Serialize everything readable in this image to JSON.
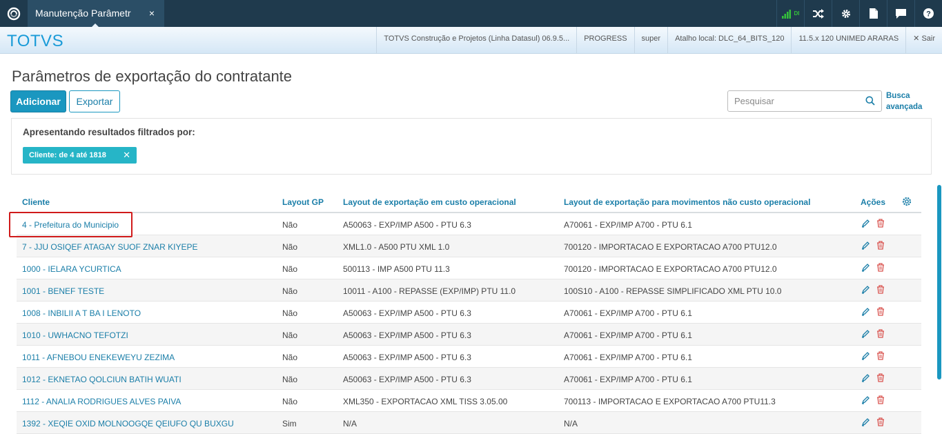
{
  "tab": {
    "title": "Manutenção Parâmetr",
    "close": "×"
  },
  "top_icons": [
    "signal-icon",
    "shuffle-icon",
    "gear-icon",
    "document-icon",
    "chat-icon",
    "help-icon"
  ],
  "signal_label": "DI",
  "header": {
    "brand": "TOTVS",
    "info": [
      "TOTVS Construção e Projetos (Linha Datasul) 06.9.5...",
      "PROGRESS",
      "super",
      "Atalho local: DLC_64_BITS_120",
      "11.5.x 120 UNIMED ARARAS"
    ],
    "logout": "Sair"
  },
  "page": {
    "title": "Parâmetros de exportação do contratante",
    "add_label": "Adicionar",
    "export_label": "Exportar",
    "search_placeholder": "Pesquisar",
    "advanced_search": "Busca avançada"
  },
  "filter": {
    "title": "Apresentando resultados filtrados por:",
    "chip": "Cliente: de 4 até 1818"
  },
  "table": {
    "headers": {
      "client": "Cliente",
      "layout_gp": "Layout GP",
      "layout_custo": "Layout de exportação em custo operacional",
      "layout_mov": "Layout de exportação para movimentos não custo operacional",
      "actions": "Ações"
    },
    "rows": [
      {
        "client": "4 - Prefeitura do Municipio",
        "gp": "Não",
        "l1": "A50063 - EXP/IMP A500 - PTU 6.3",
        "l2": "A70061 - EXP/IMP A700 - PTU 6.1"
      },
      {
        "client": "7 - JJU OSIQEF ATAGAY SUOF ZNAR KIYEPE",
        "gp": "Não",
        "l1": "XML1.0 - A500 PTU XML 1.0",
        "l2": "700120 - IMPORTACAO E EXPORTACAO A700 PTU12.0"
      },
      {
        "client": "1000 - IELARA YCURTICA",
        "gp": "Não",
        "l1": "500113 - IMP A500 PTU 11.3",
        "l2": "700120 - IMPORTACAO E EXPORTACAO A700 PTU12.0"
      },
      {
        "client": "1001 - BENEF TESTE",
        "gp": "Não",
        "l1": "10011 - A100 - REPASSE (EXP/IMP) PTU 11.0",
        "l2": "100S10 - A100 - REPASSE SIMPLIFICADO XML PTU 10.0"
      },
      {
        "client": "1008 - INBILII A T BA I LENOTO",
        "gp": "Não",
        "l1": "A50063 - EXP/IMP A500 - PTU 6.3",
        "l2": "A70061 - EXP/IMP A700 - PTU 6.1"
      },
      {
        "client": "1010 - UWHACNO TEFOTZI",
        "gp": "Não",
        "l1": "A50063 - EXP/IMP A500 - PTU 6.3",
        "l2": "A70061 - EXP/IMP A700 - PTU 6.1"
      },
      {
        "client": "1011 - AFNEBOU ENEKEWEYU ZEZIMA",
        "gp": "Não",
        "l1": "A50063 - EXP/IMP A500 - PTU 6.3",
        "l2": "A70061 - EXP/IMP A700 - PTU 6.1"
      },
      {
        "client": "1012 - EKNETAO QOLCIUN BATIH WUATI",
        "gp": "Não",
        "l1": "A50063 - EXP/IMP A500 - PTU 6.3",
        "l2": "A70061 - EXP/IMP A700 - PTU 6.1"
      },
      {
        "client": "1112 - ANALIA RODRIGUES ALVES PAIVA",
        "gp": "Não",
        "l1": "XML350 - EXPORTACAO XML TISS 3.05.00",
        "l2": "700113 - IMPORTACAO E EXPORTACAO A700 PTU11.3"
      },
      {
        "client": "1392 - XEQIE OXID MOLNOOGQE QEIUFO QU BUXGU",
        "gp": "Sim",
        "l1": "N/A",
        "l2": "N/A"
      }
    ]
  },
  "colors": {
    "accent": "#1a97c0",
    "topbar": "#1f3a4d",
    "highlight": "#d01a1a",
    "delete": "#d9534f"
  }
}
